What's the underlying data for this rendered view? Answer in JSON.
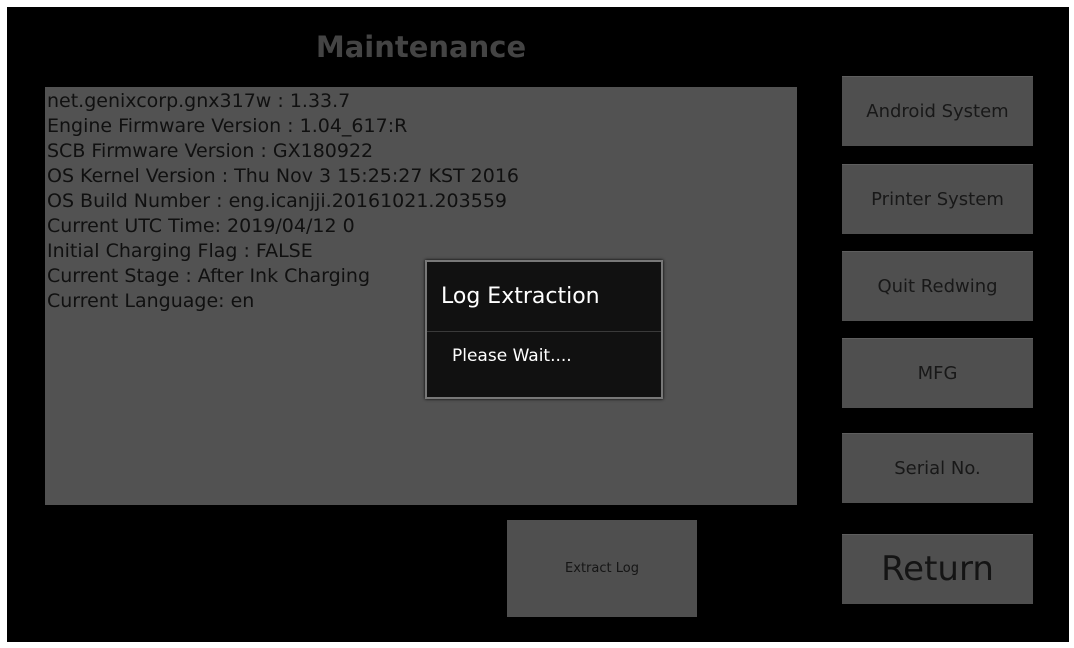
{
  "title": "Maintenance",
  "info_lines": [
    "net.genixcorp.gnx317w : 1.33.7",
    "Engine Firmware Version : 1.04_617:R",
    "SCB Firmware Version : GX180922",
    "OS Kernel Version : Thu Nov 3 15:25:27 KST 2016",
    "OS Build Number : eng.icanjji.20161021.203559",
    "Current UTC Time: 2019/04/12 0",
    "Initial Charging Flag : FALSE",
    "Current Stage : After Ink Charging",
    "Current Language: en"
  ],
  "buttons": {
    "android_system": "Android System",
    "printer_system": "Printer System",
    "quit_redwing": "Quit Redwing",
    "mfg": "MFG",
    "serial_no": "Serial No.",
    "return": "Return",
    "extract_log": "Extract Log"
  },
  "dialog": {
    "title": "Log Extraction",
    "message": "Please Wait...."
  },
  "colors": {
    "background": "#000000",
    "panel": "#525252",
    "button": "#4f4f4f",
    "dialog_bg": "#111111",
    "dialog_border": "#787878"
  }
}
